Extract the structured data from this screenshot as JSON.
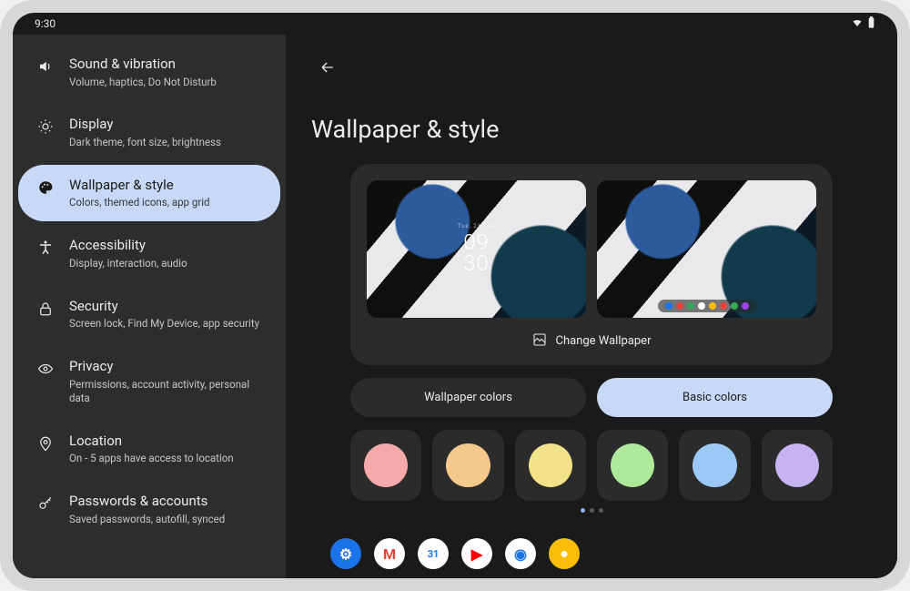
{
  "status": {
    "time": "9:30"
  },
  "sidebar": {
    "items": [
      {
        "icon": "volume-icon",
        "title": "Sound & vibration",
        "sub": "Volume, haptics, Do Not Disturb"
      },
      {
        "icon": "brightness-icon",
        "title": "Display",
        "sub": "Dark theme, font size, brightness"
      },
      {
        "icon": "palette-icon",
        "title": "Wallpaper & style",
        "sub": "Colors, themed icons, app grid",
        "active": true
      },
      {
        "icon": "accessibility-icon",
        "title": "Accessibility",
        "sub": "Display, interaction, audio"
      },
      {
        "icon": "lock-icon",
        "title": "Security",
        "sub": "Screen lock, Find My Device, app security"
      },
      {
        "icon": "privacy-icon",
        "title": "Privacy",
        "sub": "Permissions, account activity, personal data"
      },
      {
        "icon": "location-icon",
        "title": "Location",
        "sub": "On - 5 apps have access to location"
      },
      {
        "icon": "key-icon",
        "title": "Passwords & accounts",
        "sub": "Saved passwords, autofill, synced"
      }
    ]
  },
  "main": {
    "title": "Wallpaper & style",
    "change_label": "Change Wallpaper",
    "tabs": {
      "wallpaper": "Wallpaper colors",
      "basic": "Basic colors",
      "active": "basic"
    },
    "clock": {
      "date": "Tue, 21 Feb",
      "h": "09",
      "m": "30"
    },
    "colors": [
      "#f5a9a9",
      "#f5c98c",
      "#f3e28a",
      "#aee89a",
      "#9cc8f5",
      "#c6b3f3"
    ],
    "page_dots": {
      "count": 3,
      "active": 0
    }
  },
  "taskbar": {
    "apps": [
      {
        "name": "settings",
        "bg": "#1a73e8",
        "glyph": "⚙",
        "glyphColor": "#fff"
      },
      {
        "name": "gmail",
        "bg": "#ffffff",
        "glyph": "M",
        "glyphColor": "#ea4335"
      },
      {
        "name": "calendar",
        "bg": "#ffffff",
        "glyph": "31",
        "glyphColor": "#1a73e8"
      },
      {
        "name": "youtube",
        "bg": "#ffffff",
        "glyph": "▶",
        "glyphColor": "#ff0000"
      },
      {
        "name": "chrome",
        "bg": "#ffffff",
        "glyph": "◉",
        "glyphColor": "#1a73e8"
      },
      {
        "name": "keep",
        "bg": "#fbbc04",
        "glyph": "●",
        "glyphColor": "#fff"
      }
    ]
  }
}
